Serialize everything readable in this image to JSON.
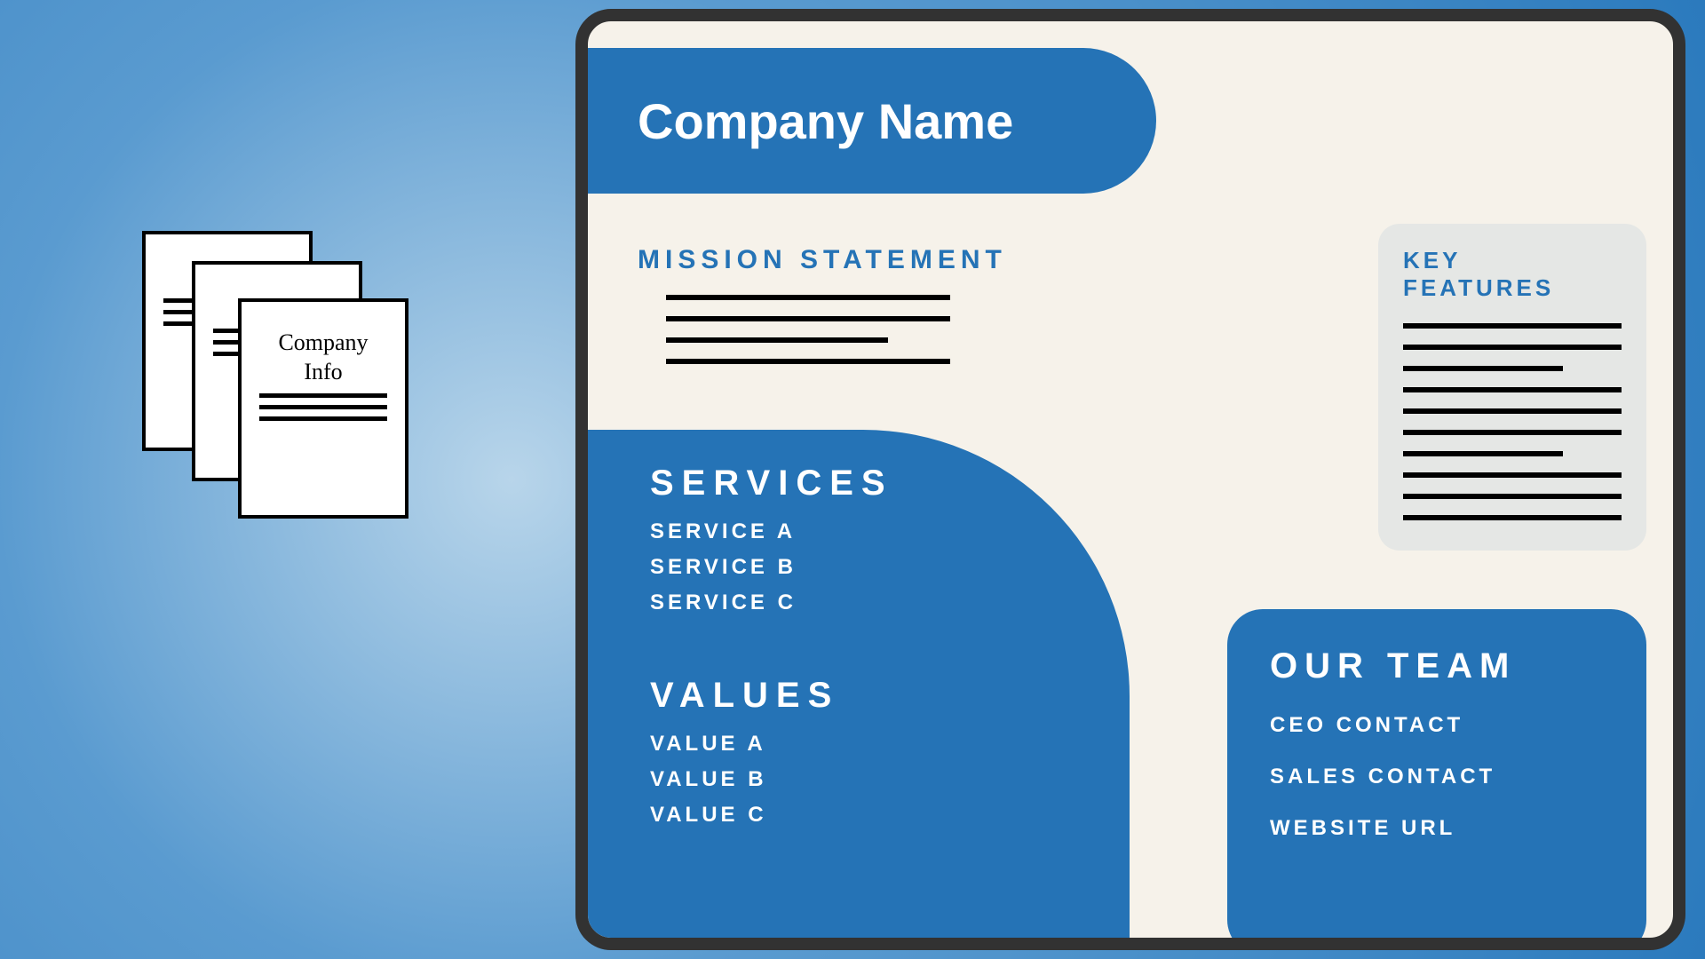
{
  "stack": {
    "front_label_line1": "Company",
    "front_label_line2": "Info"
  },
  "panel": {
    "company_name": "Company Name",
    "mission_heading": "MISSION STATEMENT",
    "key_features_heading": "KEY FEATURES",
    "services": {
      "heading": "SERVICES",
      "items": [
        "SERVICE A",
        "SERVICE B",
        "SERVICE C"
      ]
    },
    "values": {
      "heading": "VALUES",
      "items": [
        "VALUE A",
        "VALUE B",
        "VALUE C"
      ]
    },
    "team": {
      "heading": "OUR TEAM",
      "items": [
        "CEO CONTACT",
        "SALES CONTACT",
        "WEBSITE URL"
      ]
    }
  }
}
